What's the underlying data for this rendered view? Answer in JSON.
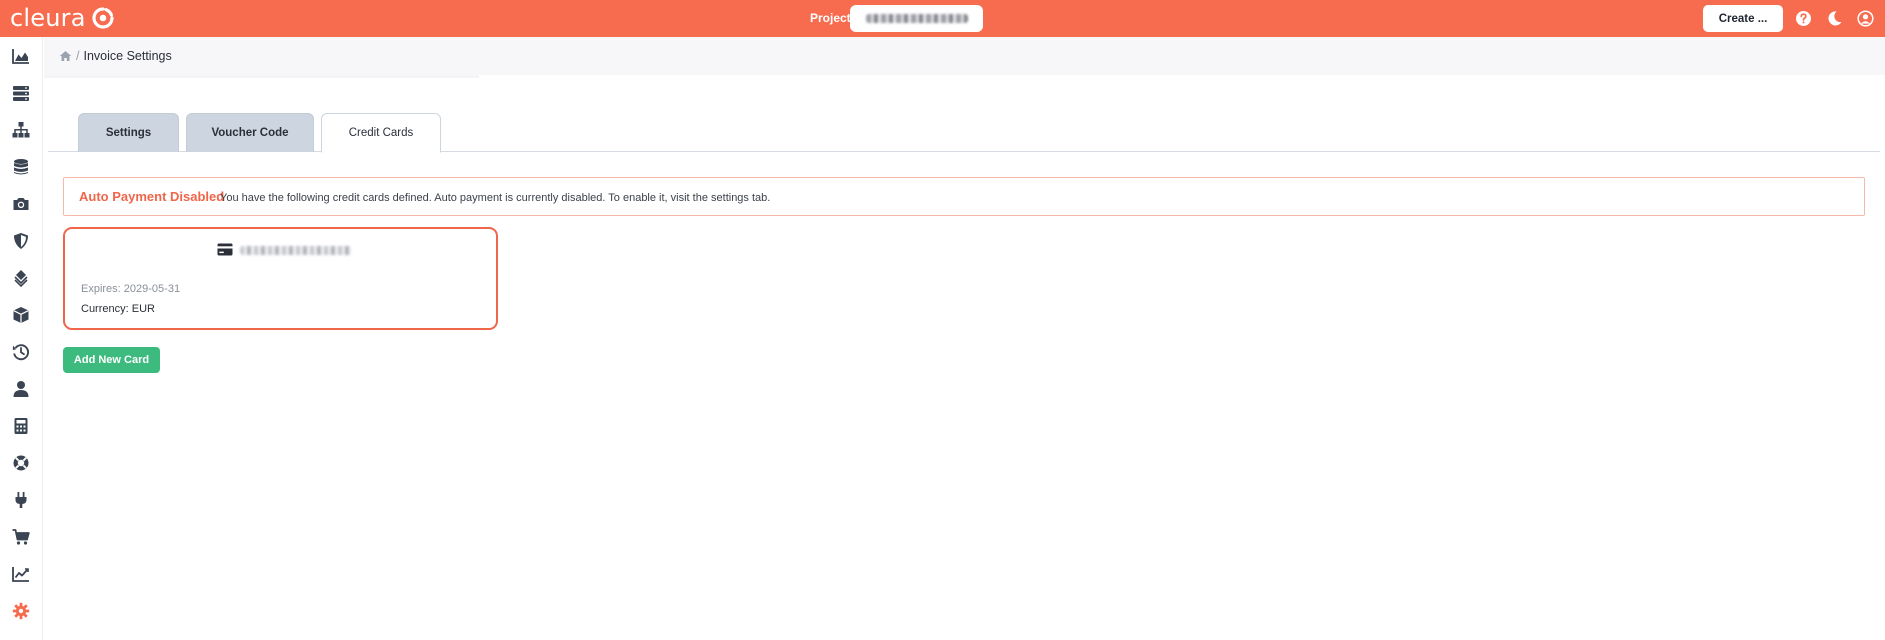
{
  "brand": {
    "name": "cleura",
    "accent": "#f76b4f",
    "success": "#3dbb7f"
  },
  "topbar": {
    "project_label": "Project",
    "create_label": "Create ...",
    "icons": [
      "help-icon",
      "dark-mode-moon-icon",
      "user-account-icon"
    ]
  },
  "sidebar": {
    "items": [
      {
        "name": "dashboard",
        "icon": "area-chart-icon"
      },
      {
        "name": "servers",
        "icon": "server-stack-icon"
      },
      {
        "name": "networking",
        "icon": "network-tree-icon"
      },
      {
        "name": "storage",
        "icon": "database-icon"
      },
      {
        "name": "snapshots",
        "icon": "camera-icon"
      },
      {
        "name": "security",
        "icon": "shield-icon"
      },
      {
        "name": "orchestration",
        "icon": "layers-icon"
      },
      {
        "name": "object-storage",
        "icon": "cube-icon"
      },
      {
        "name": "backups",
        "icon": "history-icon"
      },
      {
        "name": "users",
        "icon": "user-icon"
      },
      {
        "name": "billing",
        "icon": "calculator-icon"
      },
      {
        "name": "support",
        "icon": "life-ring-icon"
      },
      {
        "name": "integrations",
        "icon": "plug-icon"
      },
      {
        "name": "marketplace",
        "icon": "cart-icon"
      },
      {
        "name": "metrics",
        "icon": "line-chart-icon"
      },
      {
        "name": "settings",
        "icon": "gear-icon"
      }
    ]
  },
  "breadcrumb": {
    "separator": "/",
    "title": "Invoice Settings"
  },
  "tabs": [
    {
      "label": "Settings",
      "active": false
    },
    {
      "label": "Voucher Code",
      "active": false
    },
    {
      "label": "Credit Cards",
      "active": true
    }
  ],
  "alert": {
    "title": "Auto Payment Disabled",
    "message": "You have the following credit cards defined. Auto payment is currently disabled. To enable it, visit the settings tab."
  },
  "card": {
    "expires": "Expires: 2029-05-31",
    "currency": "Currency: EUR"
  },
  "add_card_label": "Add New Card"
}
